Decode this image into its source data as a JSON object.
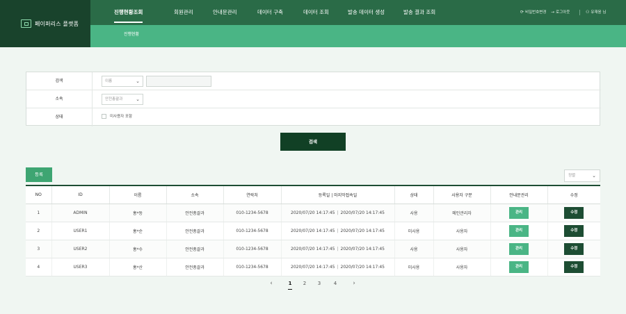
{
  "app": {
    "title": "페이퍼리스 플랫폼",
    "logo_icon": "monitor-icon"
  },
  "nav": {
    "items": [
      {
        "label": "진행현황조회",
        "active": true
      },
      {
        "label": "회원관리"
      },
      {
        "label": "안내문관리"
      },
      {
        "label": "데이터 구축"
      },
      {
        "label": "데이터 조회"
      },
      {
        "label": "발송 데이터 생성"
      },
      {
        "label": "발송 결과 조회"
      }
    ],
    "util": {
      "password_change": "비밀번호변경",
      "logout": "로그아웃",
      "user": "유재웅 님"
    }
  },
  "subnav": {
    "active": "진행현황"
  },
  "search": {
    "rows": [
      {
        "label": "검색"
      },
      {
        "label": "소속"
      },
      {
        "label": "상태"
      }
    ],
    "name_select": "이름",
    "keyword_value": "",
    "dept_select": "안전총괄과",
    "include_inactive_label": "미사용자 포함",
    "include_inactive_checked": false,
    "button": "검색"
  },
  "list": {
    "register_button": "등록",
    "sort_select": "정렬",
    "columns": [
      "NO",
      "ID",
      "이름",
      "소속",
      "연락처",
      "등록일 | 마지막접속일",
      "상태",
      "사용자 구분",
      "안내문관리",
      "수정"
    ],
    "rows": [
      {
        "no": "1",
        "id": "ADMIN",
        "name": "홍*동",
        "dept": "안전총괄과",
        "phone": "010-1234-5678",
        "registered": "2020/07/20 14:17:45",
        "last_login": "2020/07/20 14:17:45",
        "status": "사용",
        "user_type": "메인관리자",
        "manage": "관리",
        "edit": "수정"
      },
      {
        "no": "2",
        "id": "USER1",
        "name": "홍*순",
        "dept": "안전총괄과",
        "phone": "010-1234-5678",
        "registered": "2020/07/20 14:17:45",
        "last_login": "2020/07/20 14:17:45",
        "status": "미사용",
        "user_type": "사용자",
        "manage": "관리",
        "edit": "수정"
      },
      {
        "no": "3",
        "id": "USER2",
        "name": "홍*수",
        "dept": "안전총괄과",
        "phone": "010-1234-5678",
        "registered": "2020/07/20 14:17:45",
        "last_login": "2020/07/20 14:17:45",
        "status": "사용",
        "user_type": "사용자",
        "manage": "관리",
        "edit": "수정"
      },
      {
        "no": "4",
        "id": "USER3",
        "name": "홍*산",
        "dept": "안전총괄과",
        "phone": "010-1234-5678",
        "registered": "2020/07/20 14:17:45",
        "last_login": "2020/07/20 14:17:45",
        "status": "미사용",
        "user_type": "사용자",
        "manage": "관리",
        "edit": "수정"
      }
    ]
  },
  "pagination": {
    "prev_icon": "chevron-left-icon",
    "next_icon": "chevron-right-icon",
    "pages": [
      "1",
      "2",
      "3",
      "4"
    ],
    "current": "1"
  },
  "colors": {
    "brand_dark": "#19432c",
    "nav": "#2a6b47",
    "subnav": "#4ab585",
    "button_dark": "#114025",
    "button_light": "#3ea572"
  }
}
